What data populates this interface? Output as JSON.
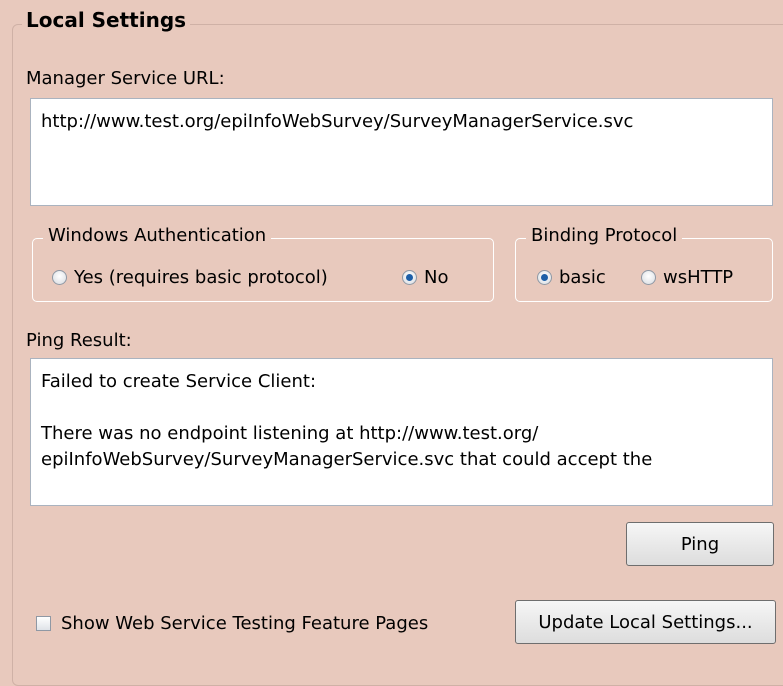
{
  "local_settings": {
    "title": "Local Settings",
    "manager_url_label": "Manager Service URL:",
    "manager_url_value": "http://www.test.org/epiInfoWebSurvey/SurveyManagerService.svc",
    "windows_auth": {
      "title": "Windows Authentication",
      "yes_label": "Yes (requires basic protocol)",
      "no_label": "No",
      "selected": "No"
    },
    "binding_protocol": {
      "title": "Binding Protocol",
      "basic_label": "basic",
      "wshttp_label": "wsHTTP",
      "selected": "basic"
    },
    "ping_result_label": "Ping Result:",
    "ping_result_text": "Failed to create Service Client:\n\nThere was no endpoint listening at http://www.test.org/\nepiInfoWebSurvey/SurveyManagerService.svc that could accept the",
    "ping_button": "Ping",
    "show_testing_pages_label": "Show Web Service Testing Feature Pages",
    "show_testing_pages_checked": false,
    "update_button": "Update Local Settings..."
  },
  "colors": {
    "background": "#e8c9bd",
    "radio_selected": "#1d5fa8"
  }
}
